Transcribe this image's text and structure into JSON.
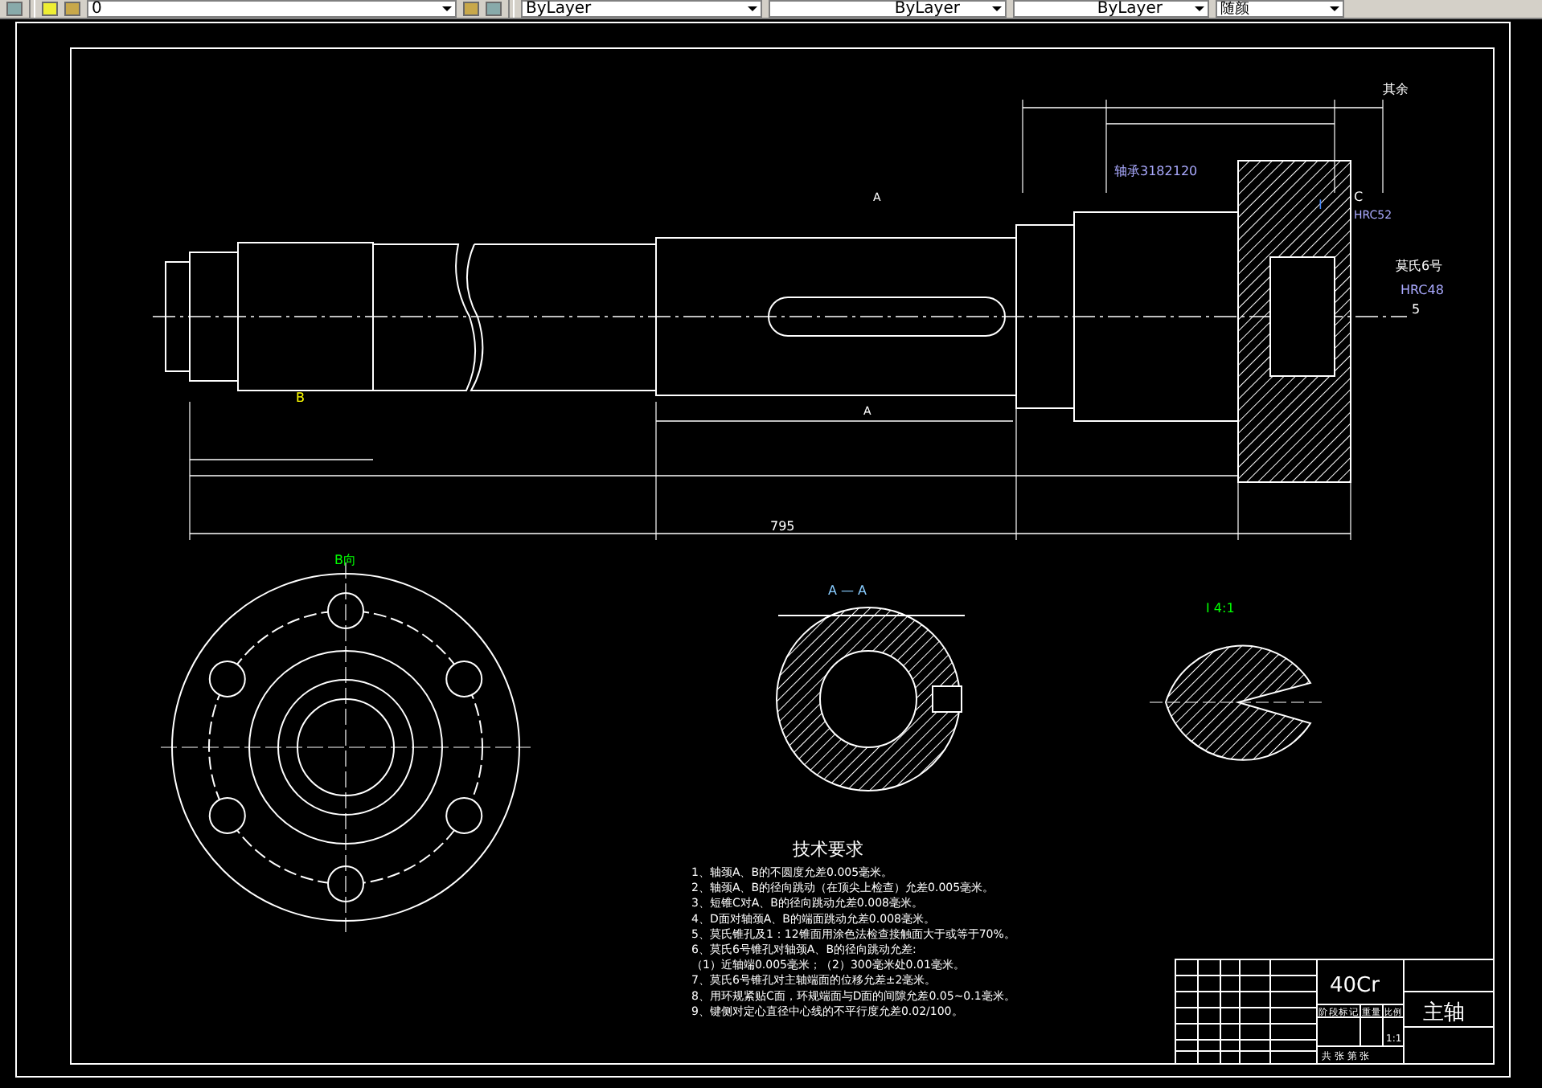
{
  "toolbar": {
    "layer": "0",
    "color_setting": "ByLayer",
    "linetype": "ByLayer",
    "lineweight": "ByLayer",
    "plot_style": "随颜"
  },
  "annotations": [
    {
      "text": "其余"
    },
    {
      "text": "轴承3182120"
    },
    {
      "text": "莫氏6号"
    },
    {
      "text": "HRC48"
    },
    {
      "text": "5"
    },
    {
      "text": "I"
    },
    {
      "text": "C"
    },
    {
      "text": "HRC52"
    },
    {
      "text": "A"
    },
    {
      "text": "A"
    },
    {
      "text": "B"
    },
    {
      "text": "795"
    },
    {
      "text": "B向"
    },
    {
      "text": "A — A"
    },
    {
      "text": "I  4:1"
    }
  ],
  "requirements": {
    "title": "技术要求",
    "items": [
      "1、轴颈A、B的不圆度允差0.005毫米。",
      "2、轴颈A、B的径向跳动（在顶尖上检查）允差0.005毫米。",
      "3、短锥C对A、B的径向跳动允差0.008毫米。",
      "4、D面对轴颈A、B的端面跳动允差0.008毫米。",
      "5、莫氏锥孔及1：12锥面用涂色法检查接触面大于或等于70%。",
      "6、莫氏6号锥孔对轴颈A、B的径向跳动允差:",
      "（1）近轴端0.005毫米；（2）300毫米处0.01毫米。",
      "7、莫氏6号锥孔对主轴端面的位移允差±2毫米。",
      "8、用环规紧贴C面，环规端面与D面的间隙允差0.05~0.1毫米。",
      "9、键侧对定心直径中心线的不平行度允差0.02/100。"
    ]
  },
  "title_block": {
    "material": "40Cr",
    "part_name": "主轴",
    "headers": [
      "阶段标记",
      "重量",
      "比例"
    ],
    "scale": "1:1",
    "sheet": "共 张 第 张"
  }
}
